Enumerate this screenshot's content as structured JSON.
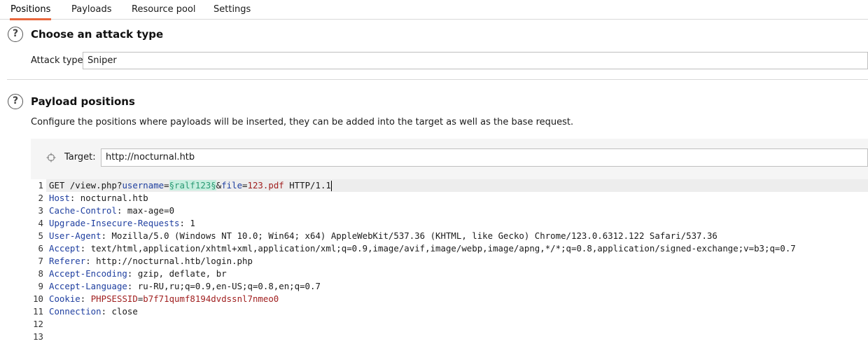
{
  "tabs": [
    {
      "label": "Positions",
      "active": true
    },
    {
      "label": "Payloads",
      "active": false
    },
    {
      "label": "Resource pool",
      "active": false
    },
    {
      "label": "Settings",
      "active": false
    }
  ],
  "attack_section": {
    "title": "Choose an attack type",
    "attack_type_label": "Attack type:",
    "attack_type_value": "Sniper"
  },
  "positions_section": {
    "title": "Payload positions",
    "description": "Configure the positions where payloads will be inserted, they can be added into the target as well as the base request."
  },
  "target": {
    "label": "Target:",
    "value": "http://nocturnal.htb"
  },
  "request": {
    "line1": {
      "method_path": "GET /view.php?",
      "p1_key": "username",
      "eq1": "=",
      "payload": "§ralf123§",
      "amp": "&",
      "p2_key": "file",
      "eq2": "=",
      "p2_val": "123.pdf",
      "proto": " HTTP/1.1"
    },
    "headers": [
      {
        "name": "Host",
        "value": " nocturnal.htb"
      },
      {
        "name": "Cache-Control",
        "value": " max-age=0"
      },
      {
        "name": "Upgrade-Insecure-Requests",
        "value": " 1"
      },
      {
        "name": "User-Agent",
        "value": " Mozilla/5.0 (Windows NT 10.0; Win64; x64) AppleWebKit/537.36 (KHTML, like Gecko) Chrome/123.0.6312.122 Safari/537.36"
      },
      {
        "name": "Accept",
        "value": " text/html,application/xhtml+xml,application/xml;q=0.9,image/avif,image/webp,image/apng,*/*;q=0.8,application/signed-exchange;v=b3;q=0.7"
      },
      {
        "name": "Referer",
        "value": " http://nocturnal.htb/login.php"
      },
      {
        "name": "Accept-Encoding",
        "value": " gzip, deflate, br"
      },
      {
        "name": "Accept-Language",
        "value": " ru-RU,ru;q=0.9,en-US;q=0.8,en;q=0.7"
      }
    ],
    "cookie": {
      "name": "Cookie",
      "sep": ": ",
      "key": "PHPSESSID",
      "eq": "=",
      "value": "b7f71qumf8194dvdssnl7nmeo0"
    },
    "connection": {
      "name": "Connection",
      "value": " close"
    },
    "line_numbers": [
      "1",
      "2",
      "3",
      "4",
      "5",
      "6",
      "7",
      "8",
      "9",
      "10",
      "11",
      "12",
      "13"
    ]
  },
  "icons": {
    "help": "help-circle-icon",
    "target": "crosshair-icon"
  },
  "colors": {
    "active_tab": "#e8663d",
    "header_name": "#1f3fa0",
    "param_value": "#a01f1f",
    "payload_marker_bg": "#c8efe0"
  }
}
